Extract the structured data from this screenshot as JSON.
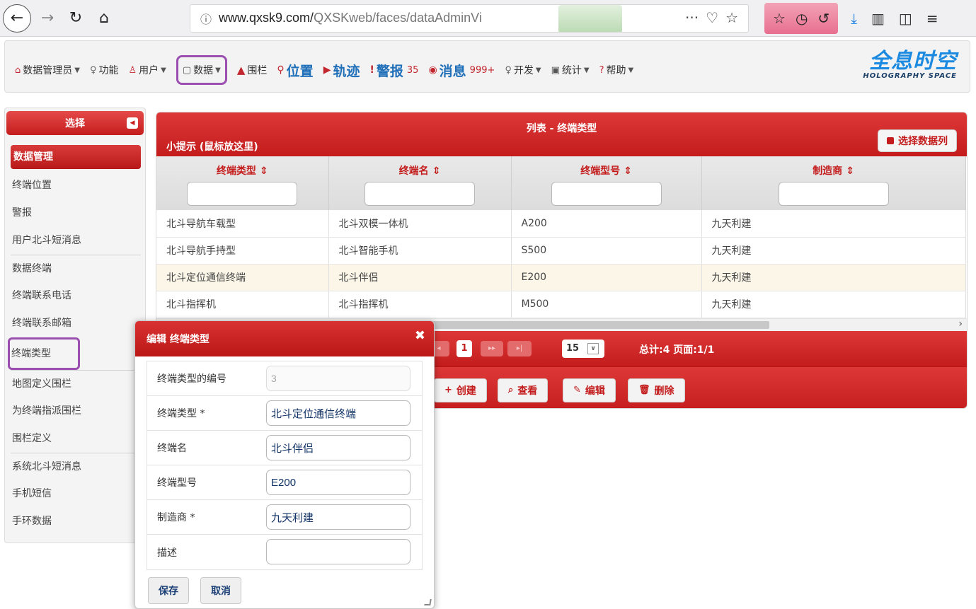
{
  "browser": {
    "url_main": "www.qxsk9.com/",
    "url_rest": "QXSKweb/faces/dataAdminVi",
    "more_label": "···"
  },
  "menu": {
    "items": [
      {
        "label": "数据管理员",
        "icon": "home-icon",
        "caret": true
      },
      {
        "label": "功能",
        "icon": "bulb-icon",
        "caret": false
      },
      {
        "label": "用户",
        "icon": "user-icon",
        "caret": true
      },
      {
        "label": "数据",
        "icon": "file-icon",
        "caret": true
      },
      {
        "label": "围栏",
        "icon": "warning-icon",
        "caret": false
      }
    ],
    "big_items": [
      {
        "label": "位置",
        "icon": "pin-icon",
        "badge": ""
      },
      {
        "label": "轨迹",
        "icon": "play-icon",
        "badge": ""
      },
      {
        "label": "警报",
        "icon": "exclamation-icon",
        "badge": "35"
      },
      {
        "label": "消息",
        "icon": "message-icon",
        "badge": "999+"
      }
    ],
    "tail_items": [
      {
        "label": "开发",
        "icon": "bulb-icon"
      },
      {
        "label": "统计",
        "icon": "image-icon"
      },
      {
        "label": "帮助",
        "icon": "question-icon"
      }
    ]
  },
  "logo": {
    "cn": "全息时空",
    "en": "HOLOGRAPHY SPACE"
  },
  "sidebar": {
    "title": "选择",
    "items": [
      {
        "label": "数据管理",
        "active": true
      },
      {
        "label": "终端位置"
      },
      {
        "label": "警报"
      },
      {
        "label": "用户北斗短消息"
      },
      {
        "label": "数据终端",
        "sep": true
      },
      {
        "label": "终端联系电话"
      },
      {
        "label": "终端联系邮箱"
      },
      {
        "label": "终端类型",
        "marked": true
      },
      {
        "label": "地图定义围栏",
        "sep": true
      },
      {
        "label": "为终端指派围栏"
      },
      {
        "label": "围栏定义"
      },
      {
        "label": "系统北斗短消息",
        "sep": true
      },
      {
        "label": "手机短信"
      },
      {
        "label": "手环数据"
      }
    ]
  },
  "list": {
    "title": "列表 - 终端类型",
    "hint": "小提示 (鼠标放这里)",
    "select_columns_label": "选择数据列",
    "columns": [
      "终端类型",
      "终端名",
      "终端型号",
      "制造商"
    ],
    "rows": [
      [
        "北斗导航车载型",
        "北斗双模一体机",
        "A200",
        "九天利建"
      ],
      [
        "北斗导航手持型",
        "北斗智能手机",
        "S500",
        "九天利建"
      ],
      [
        "北斗定位通信终端",
        "北斗伴侣",
        "E200",
        "九天利建"
      ],
      [
        "北斗指挥机",
        "北斗指挥机",
        "M500",
        "九天利建"
      ]
    ],
    "selected_row": 2
  },
  "pager": {
    "current_page": "1",
    "page_size": "15",
    "total": "总计:4 页面:1/1"
  },
  "actions": {
    "create": "创建",
    "view": "查看",
    "edit": "编辑",
    "delete": "删除"
  },
  "dialog": {
    "title": "编辑 终端类型",
    "fields": [
      {
        "label": "终端类型的编号",
        "value": "3",
        "disabled": true
      },
      {
        "label": "终端类型 *",
        "value": "北斗定位通信终端"
      },
      {
        "label": "终端名",
        "value": "北斗伴侣"
      },
      {
        "label": "终端型号",
        "value": "E200"
      },
      {
        "label": "制造商 *",
        "value": "九天利建"
      },
      {
        "label": "描述",
        "value": ""
      }
    ],
    "save_label": "保存",
    "cancel_label": "取消"
  },
  "colors": {
    "accent_red": "#c41c1c",
    "annotation_purple": "#9b4fb0",
    "link_blue": "#1f6fb9"
  }
}
